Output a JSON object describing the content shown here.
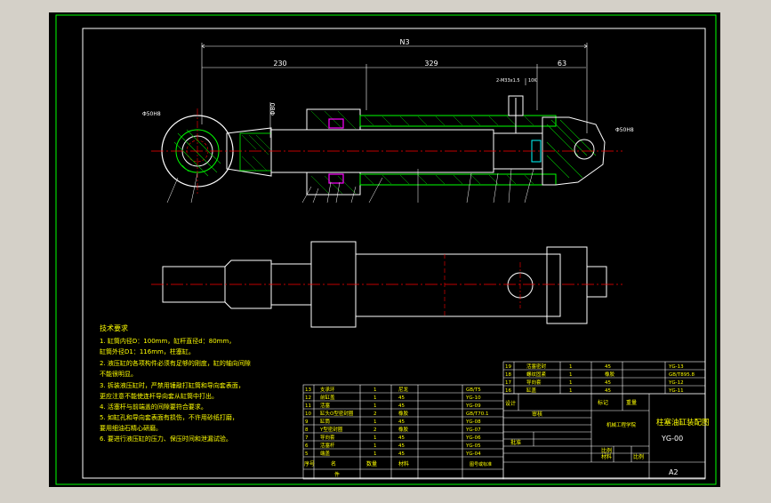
{
  "colors": {
    "canvas_bg": "#d4d0c8",
    "sheet_bg": "#000000",
    "line_white": "#ffffff",
    "line_green": "#00ff00",
    "line_red": "#ff0000",
    "line_cyan": "#00ffff",
    "line_magenta": "#ff00ff",
    "text_yellow": "#ffff00",
    "text_white": "#ffffff",
    "hatch_green": "#00cc00"
  },
  "dimensions": {
    "overall": "N3",
    "left_length": "230",
    "mid_length": "329",
    "right_length": "63",
    "rod_dia": "Φ80",
    "eye_left": "Φ50H8",
    "eye_right": "Φ50H8",
    "thread_note": "2-M33x1.5",
    "port_note": "10K"
  },
  "tech_requirements": {
    "title": "技术要求",
    "lines": [
      "1. 缸筒内径D：100mm，缸杆直径d：80mm，",
      "缸筒外径D1：116mm，柱塞缸。",
      "2. 液压缸的各项构件必须有足够的刚度，缸的轴向间隙",
      "不能很明显。",
      "3. 拆装液压缸时，严禁用锤敲打缸筒和导向套表面，",
      "更应注意不能使连杆导向套从缸筒中打出。",
      "4. 活塞杆与前端盖的间隙要符合要求。",
      "5. 如缸孔和导向套表面有损伤，不许用砂纸打磨，",
      "要用细油石精心研磨。",
      "6. 要进行液压缸的压力、保压时间和泄漏试验。"
    ]
  },
  "upper_parts": [
    {
      "no": "19",
      "name": "活塞密封",
      "qty": "1",
      "material": "45",
      "code": "YG-13"
    },
    {
      "no": "18",
      "name": "螺纹固紧",
      "qty": "1",
      "material": "橡胶",
      "code": "GB/T895.8"
    },
    {
      "no": "17",
      "name": "导向套",
      "qty": "1",
      "material": "45",
      "code": "YG-12"
    },
    {
      "no": "16",
      "name": "缸盖",
      "qty": "1",
      "material": "45",
      "code": "YG-11"
    }
  ],
  "lower_parts": [
    {
      "no": "13",
      "name": "支承环",
      "qty": "1",
      "material": "尼龙",
      "code": "GB/T5"
    },
    {
      "no": "12",
      "name": "前缸盖",
      "qty": "1",
      "material": "45",
      "code": "YG-10"
    },
    {
      "no": "11",
      "name": "活塞",
      "qty": "1",
      "material": "45",
      "code": "YG-09"
    },
    {
      "no": "10",
      "name": "缸头O型密封圈",
      "qty": "2",
      "material": "橡胶",
      "code": "GB/T70.1"
    },
    {
      "no": "9",
      "name": "缸筒",
      "qty": "1",
      "material": "45",
      "code": "YG-08"
    },
    {
      "no": "8",
      "name": "Y型密封圈",
      "qty": "2",
      "material": "橡胶",
      "code": "YG-07"
    },
    {
      "no": "7",
      "name": "导向套",
      "qty": "1",
      "material": "45",
      "code": "YG-06"
    },
    {
      "no": "6",
      "name": "活塞杆",
      "qty": "1",
      "material": "45",
      "code": "YG-05"
    },
    {
      "no": "5",
      "name": "端盖",
      "qty": "1",
      "material": "45",
      "code": "YG-04"
    }
  ],
  "bom_header": {
    "no": "序号",
    "name": "名",
    "qty": "数量",
    "material": "材料",
    "code": "图号或标准",
    "footer": "件"
  },
  "title_block": {
    "title": "柱塞油缸装配图",
    "drawing_no": "YG-00",
    "sheet_size": "A2",
    "designer_label": "设计",
    "check_label": "审核",
    "approve_label": "批准",
    "scale_label": "比例",
    "material_label": "材料",
    "school": "机械工程学院",
    "mark_label": "标记",
    "weight_label": "重量",
    "ratio_label": "比例"
  }
}
